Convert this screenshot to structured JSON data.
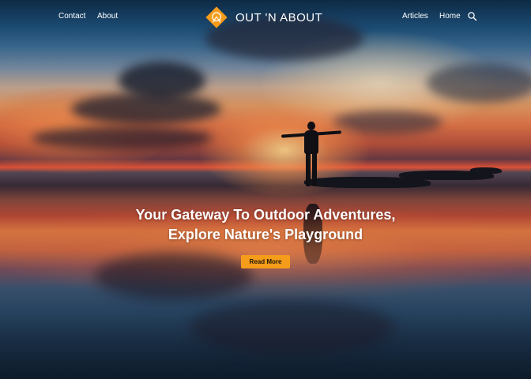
{
  "nav": {
    "left_links": [
      {
        "label": "Contact"
      },
      {
        "label": "About"
      }
    ],
    "right_links": [
      {
        "label": "Articles"
      },
      {
        "label": "Home"
      }
    ],
    "search_icon": "search-icon"
  },
  "logo": {
    "text": "OUT 'N ABOUT",
    "mark_color": "#f59c1a"
  },
  "hero": {
    "title_line_1": "Your Gateway To Outdoor Adventures,",
    "title_line_2": "Explore Nature's Playground",
    "cta_label": "Read More",
    "cta_color": "#f59c1a"
  }
}
